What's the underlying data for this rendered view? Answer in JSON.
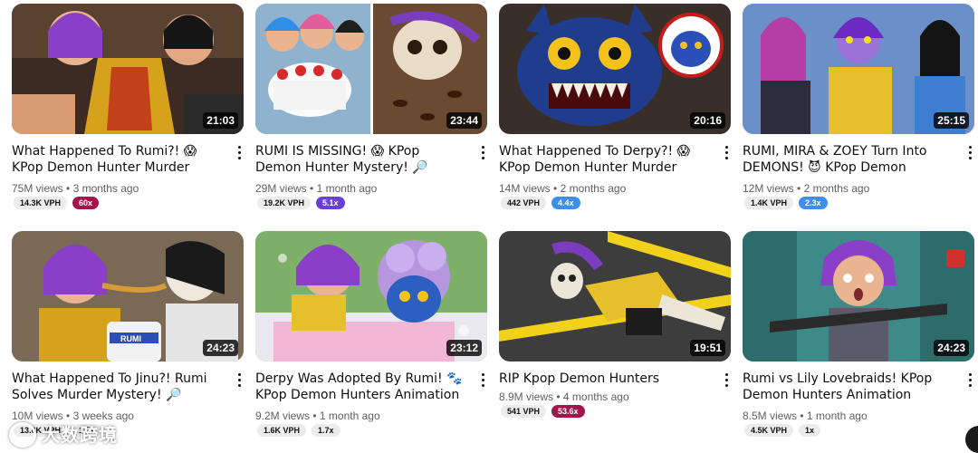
{
  "videos": [
    {
      "title": "What Happened To Rumi?! 😱 KPop Demon Hunter Murder Mystery! 🔎",
      "duration": "21:03",
      "views": "75M views",
      "age": "3 months ago",
      "vph": "14.3K VPH",
      "multiplier": "60x",
      "multiplier_color": "#a3144a",
      "thumb_icon": "jacket-shock-scene"
    },
    {
      "title": "RUMI IS MISSING! 😱 KPop Demon Hunter Mystery! 🔎",
      "duration": "23:44",
      "views": "29M views",
      "age": "1 month ago",
      "vph": "19.2K VPH",
      "multiplier": "5.1x",
      "multiplier_color": "#6a3fd6",
      "thumb_icon": "cake-and-skeleton-scene"
    },
    {
      "title": "What Happened To Derpy?! 😱 KPop Demon Hunter Murder Mystery! 🔎",
      "duration": "20:16",
      "views": "14M views",
      "age": "2 months ago",
      "vph": "442 VPH",
      "multiplier": "4.4x",
      "multiplier_color": "#3d8ef0",
      "thumb_icon": "blue-monster-scene"
    },
    {
      "title": "RUMI, MIRA & ZOEY Turn Into DEMONS! 😈 KPop Demon Hunters ...",
      "duration": "25:15",
      "views": "12M views",
      "age": "2 months ago",
      "vph": "1.4K VPH",
      "multiplier": "2.3x",
      "multiplier_color": "#3d8ef0",
      "thumb_icon": "three-demons-scene"
    },
    {
      "title": "What Happened To Jinu?! Rumi Solves Murder Mystery! 🔎",
      "duration": "24:23",
      "views": "10M views",
      "age": "3 weeks ago",
      "vph": "13.6K VPH",
      "multiplier": "1.5x",
      "multiplier_color": "#ececec",
      "thumb_icon": "noodles-skeleton-scene"
    },
    {
      "title": "Derpy Was Adopted By Rumi! 🐾 KPop Demon Hunters Animation",
      "duration": "23:12",
      "views": "9.2M views",
      "age": "1 month ago",
      "vph": "1.6K VPH",
      "multiplier": "1.7x",
      "multiplier_color": "#ececec",
      "thumb_icon": "bath-cat-scene"
    },
    {
      "title": "RIP Kpop Demon Hunters",
      "duration": "19:51",
      "views": "8.9M views",
      "age": "4 months ago",
      "vph": "541 VPH",
      "multiplier": "53.6x",
      "multiplier_color": "#a3144a",
      "thumb_icon": "skeleton-crime-scene"
    },
    {
      "title": "Rumi vs Lily Lovebraids! KPop Demon Hunters Animation",
      "duration": "24:23",
      "views": "8.5M views",
      "age": "1 month ago",
      "vph": "4.5K VPH",
      "multiplier": "1x",
      "multiplier_color": "#ececec",
      "thumb_icon": "seatbelt-scene"
    }
  ],
  "watermark": "大数跨境",
  "colors": {
    "text": "#0f0f0f",
    "secondary": "#606060",
    "vph_bg": "#ececec"
  }
}
